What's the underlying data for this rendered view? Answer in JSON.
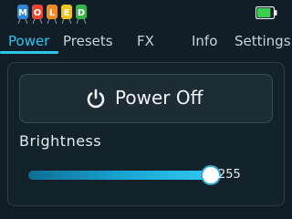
{
  "status_bar": {
    "logo_letters": [
      "M",
      "O",
      "L",
      "E",
      "D"
    ],
    "logo_colors": [
      "#2f86d6",
      "#e8462f",
      "#f08a24",
      "#f2c21b",
      "#36b34a"
    ],
    "battery": {
      "level": 0.85,
      "color": "#3ccf4e"
    }
  },
  "tabs": [
    {
      "label": "Power",
      "active": true
    },
    {
      "label": "Presets",
      "active": false
    },
    {
      "label": "FX",
      "active": false
    },
    {
      "label": "Info",
      "active": false
    },
    {
      "label": "Settings",
      "active": false
    }
  ],
  "power": {
    "button_label": "Power Off",
    "icon": "power-icon"
  },
  "brightness": {
    "label": "Brightness",
    "value": 255,
    "value_text": "255",
    "min": 0,
    "max": 255
  },
  "colors": {
    "accent": "#2ec4ec",
    "background": "#111e27"
  }
}
